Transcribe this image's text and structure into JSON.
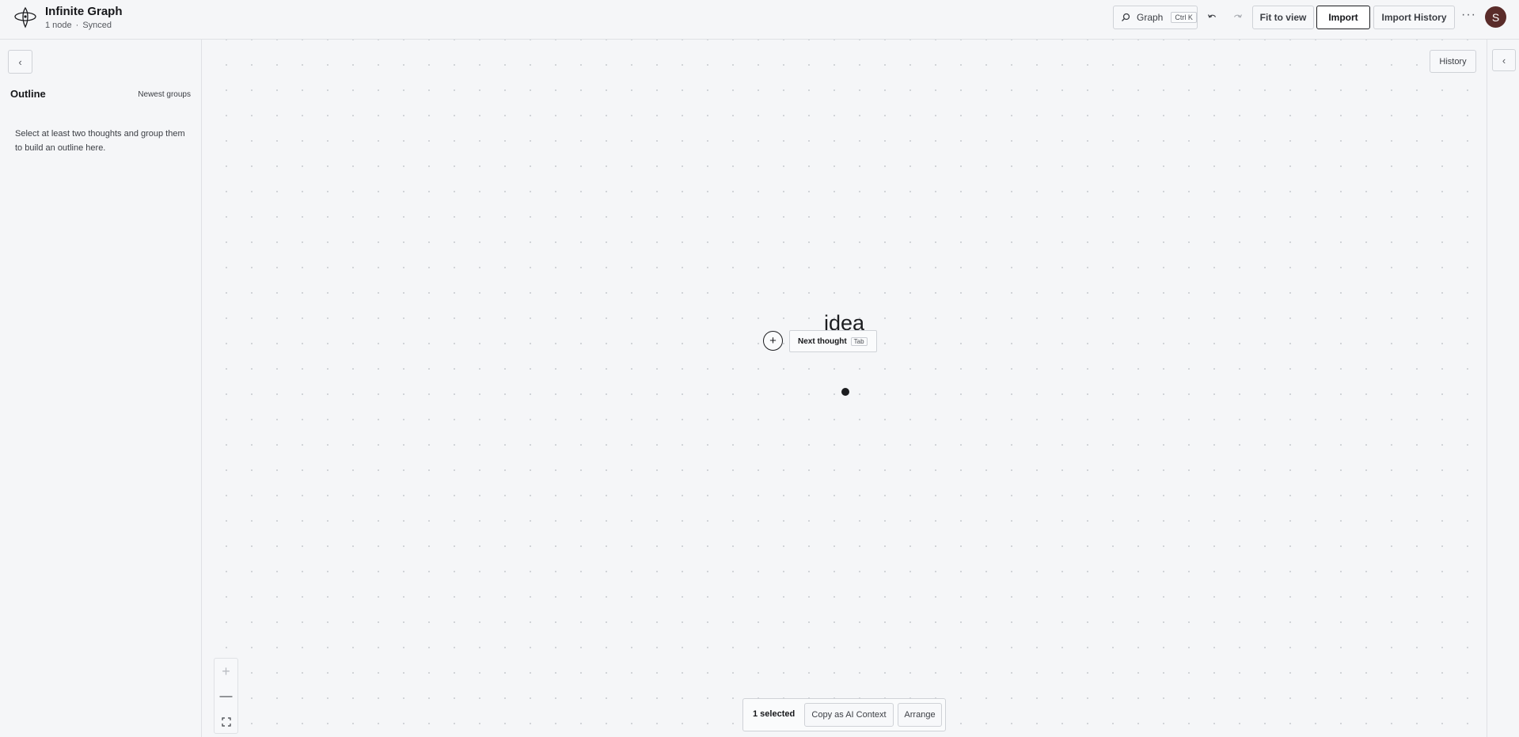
{
  "app": {
    "title": "Infinite Graph",
    "node_count": "1 node",
    "separator": "·",
    "sync_status": "Synced"
  },
  "toolbar": {
    "search_label": "Graph",
    "search_shortcut": "Ctrl K",
    "undo_icon": "undo-icon",
    "redo_icon": "redo-icon",
    "fit_to_view": "Fit to view",
    "import": "Import",
    "import_history": "Import History",
    "more": "···",
    "avatar_initial": "S"
  },
  "sidebar": {
    "collapse_glyph": "‹",
    "title": "Outline",
    "sort": "Newest groups",
    "empty_message": "Select at least two thoughts and group them to build an outline here."
  },
  "canvas": {
    "history": "History",
    "node_label": "idea",
    "add_glyph": "+",
    "next_thought": "Next thought",
    "next_thought_shortcut": "Tab",
    "zoom_in_glyph": "+",
    "zoom_out_glyph": "—"
  },
  "right_rail": {
    "collapse_glyph": "‹"
  },
  "selection": {
    "count": "1 selected",
    "copy_ai": "Copy as AI Context",
    "arrange": "Arrange"
  },
  "colors": {
    "background": "#f5f6f8",
    "border": "#dfe1e5",
    "text": "#1c1d20",
    "avatar": "#5a2c2a"
  }
}
